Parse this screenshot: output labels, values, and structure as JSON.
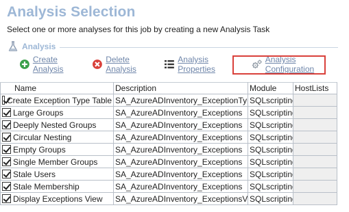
{
  "header": {
    "title": "Analysis Selection",
    "subtitle": "Select one or more analyses for this job by creating a new Analysis Task"
  },
  "section": {
    "label": "Analysis",
    "icon": "flask-icon"
  },
  "toolbar": {
    "items": [
      {
        "label": "Create Analysis",
        "icon": "plus-circle-icon"
      },
      {
        "label": "Delete Analysis",
        "icon": "delete-x-icon"
      },
      {
        "label": "Analysis Properties",
        "icon": "list-icon"
      },
      {
        "label": "Analysis Configuration",
        "icon": "gears-icon"
      }
    ],
    "highlight_color": "#d9403a"
  },
  "table": {
    "columns": [
      "Name",
      "Description",
      "Module",
      "HostLists"
    ],
    "rows": [
      {
        "checked": true,
        "name": "Create Exception Type Table",
        "description": "SA_AzureADInventory_ExceptionTypes",
        "module": "SQLscripting",
        "hostlists": ""
      },
      {
        "checked": true,
        "name": "Large Groups",
        "description": "SA_AzureADInventory_Exceptions",
        "module": "SQLscripting",
        "hostlists": ""
      },
      {
        "checked": true,
        "name": "Deeply Nested Groups",
        "description": "SA_AzureADInventory_Exceptions",
        "module": "SQLscripting",
        "hostlists": ""
      },
      {
        "checked": true,
        "name": "Circular Nesting",
        "description": "SA_AzureADInventory_Exceptions",
        "module": "SQLscripting",
        "hostlists": ""
      },
      {
        "checked": true,
        "name": "Empty Groups",
        "description": "SA_AzureADInventory_Exceptions",
        "module": "SQLscripting",
        "hostlists": ""
      },
      {
        "checked": true,
        "name": "Single Member Groups",
        "description": "SA_AzureADInventory_Exceptions",
        "module": "SQLscripting",
        "hostlists": ""
      },
      {
        "checked": true,
        "name": "Stale Users",
        "description": "SA_AzureADInventory_Exceptions",
        "module": "SQLscripting",
        "hostlists": ""
      },
      {
        "checked": true,
        "name": "Stale Membership",
        "description": "SA_AzureADInventory_Exceptions",
        "module": "SQLscripting",
        "hostlists": ""
      },
      {
        "checked": true,
        "name": "Display Exceptions View",
        "description": "SA_AzureADInventory_ExceptionsView",
        "module": "SQLscripting",
        "hostlists": ""
      }
    ]
  },
  "colors": {
    "title": "#9db7d6",
    "link": "#6f86aa",
    "create_icon": "#3aa04a",
    "delete_icon": "#d9403a"
  }
}
